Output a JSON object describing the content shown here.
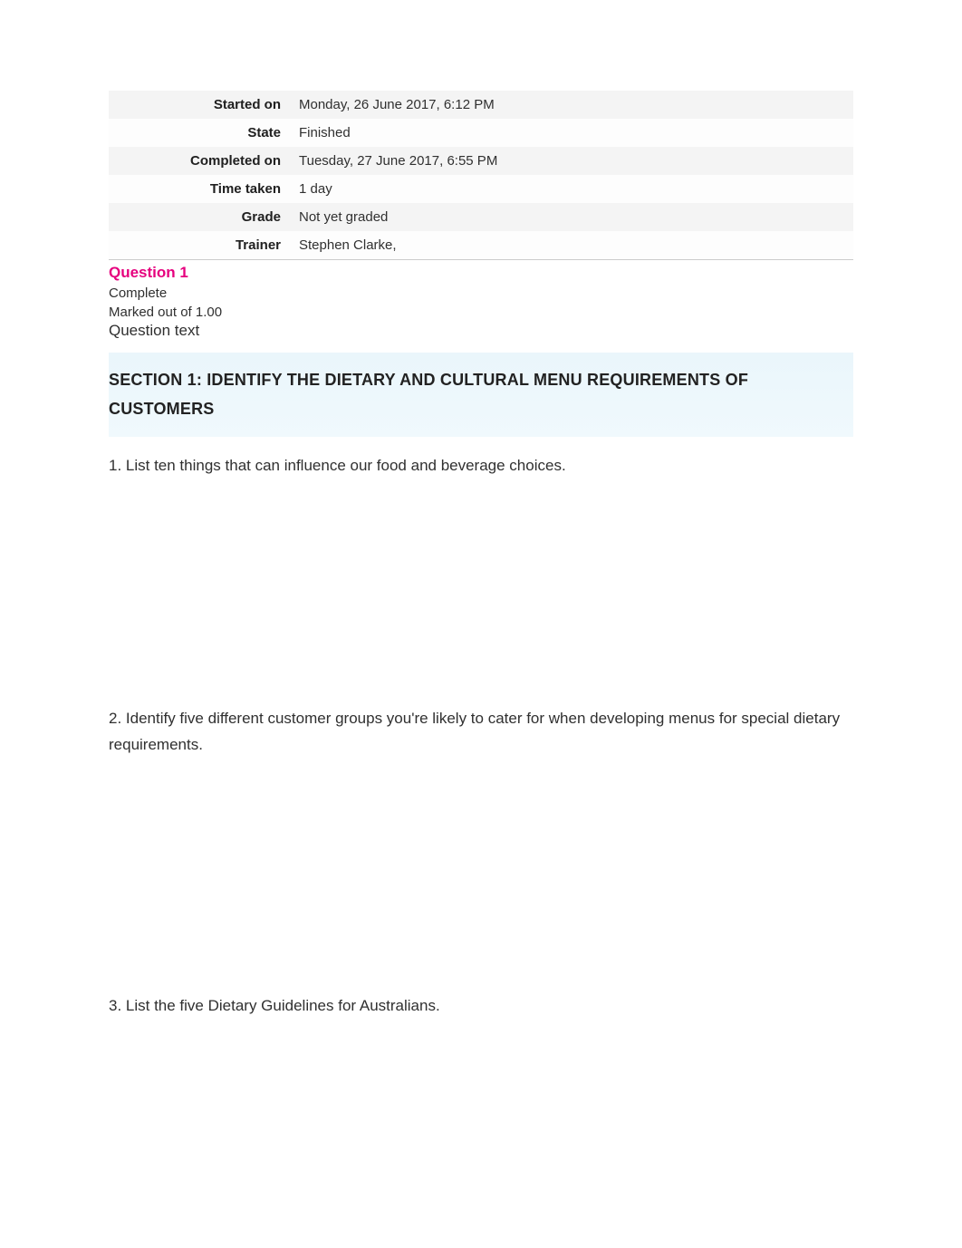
{
  "attempt_info": {
    "started_on": {
      "label": "Started on",
      "value": "Monday, 26 June 2017, 6:12 PM"
    },
    "state": {
      "label": "State",
      "value": "Finished"
    },
    "completed_on": {
      "label": "Completed on",
      "value": "Tuesday, 27 June 2017, 6:55 PM"
    },
    "time_taken": {
      "label": "Time taken",
      "value": "1 day"
    },
    "grade": {
      "label": "Grade",
      "value": "Not yet graded"
    },
    "trainer": {
      "label": "Trainer",
      "value": "Stephen Clarke,"
    }
  },
  "question": {
    "heading": "Question 1",
    "status": "Complete",
    "marked": "Marked out of 1.00",
    "text_heading": "Question text"
  },
  "section": {
    "title": "SECTION 1: IDENTIFY THE DIETARY AND CULTURAL MENU REQUIREMENTS OF CUSTOMERS"
  },
  "questions": {
    "q1": "1. List ten things that can influence our food and beverage choices.",
    "q2": "2. Identify five different customer groups you're likely to cater for when developing menus for special dietary requirements.",
    "q3": "3. List the five Dietary Guidelines for Australians."
  }
}
